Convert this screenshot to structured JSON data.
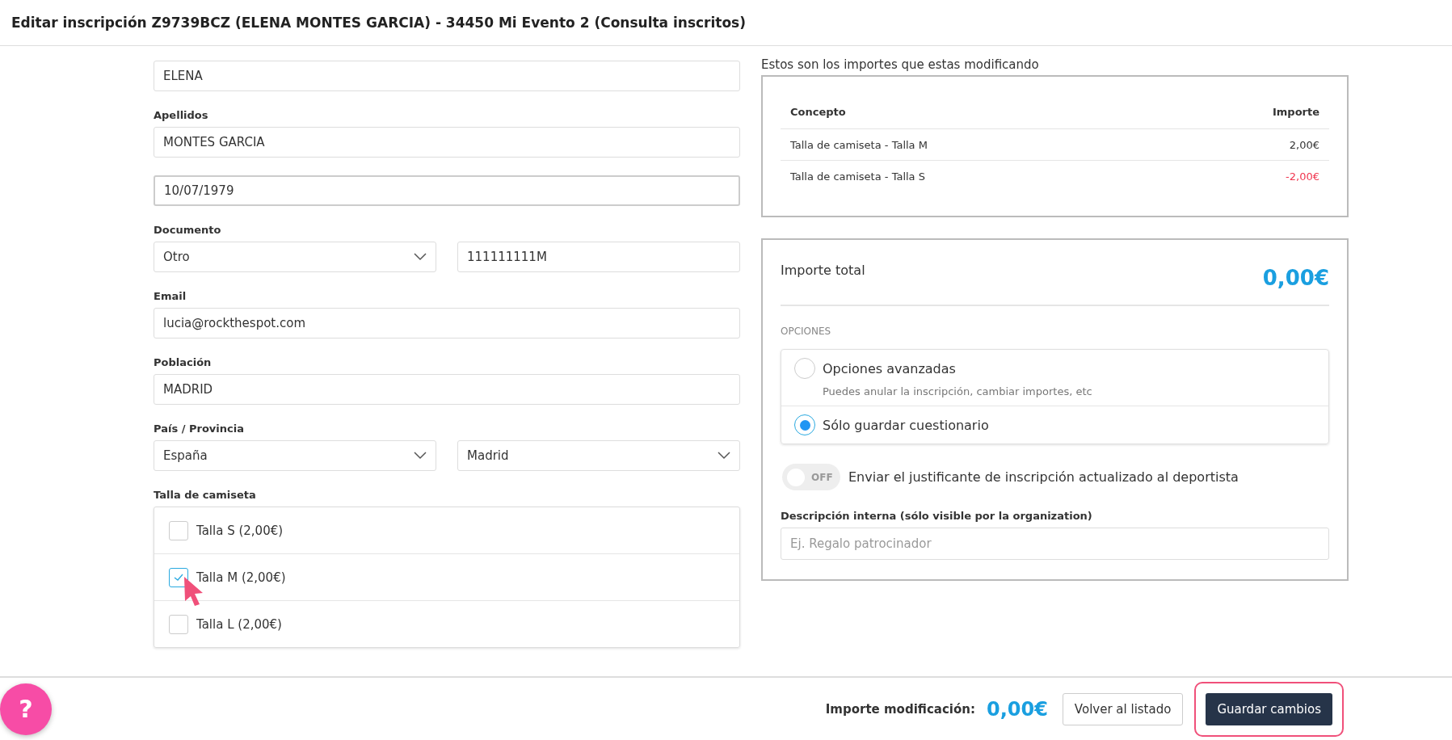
{
  "title": "Editar inscripción Z9739BCZ (ELENA MONTES GARCIA) - 34450 Mi Evento 2 (Consulta inscritos)",
  "form": {
    "rows": [
      {
        "controls": [
          {
            "kind": "input",
            "value": "ELENA"
          }
        ]
      },
      {
        "label": "Apellidos",
        "controls": [
          {
            "kind": "input",
            "value": "MONTES GARCIA"
          }
        ]
      },
      {
        "controls": [
          {
            "kind": "date",
            "value": "10/07/1979"
          }
        ]
      },
      {
        "label": "Documento",
        "controls": [
          {
            "kind": "select",
            "value": "Otro"
          },
          {
            "kind": "input",
            "value": "111111111M"
          }
        ]
      },
      {
        "label": "Email",
        "controls": [
          {
            "kind": "input",
            "value": "lucia@rockthespot.com"
          }
        ]
      },
      {
        "label": "Población",
        "controls": [
          {
            "kind": "input",
            "value": "MADRID"
          }
        ]
      },
      {
        "label": "País / Provincia",
        "controls": [
          {
            "kind": "select",
            "value": "España"
          },
          {
            "kind": "select",
            "value": "Madrid"
          }
        ]
      }
    ],
    "shirt": {
      "label": "Talla de camiseta",
      "options": [
        {
          "label": "Talla S (2,00€)",
          "checked": false
        },
        {
          "label": "Talla M (2,00€)",
          "checked": true
        },
        {
          "label": "Talla L (2,00€)",
          "checked": false
        }
      ]
    }
  },
  "summary": {
    "caption": "Estos son los importes que estas modificando",
    "columns": [
      "Concepto",
      "Importe"
    ],
    "rows": [
      {
        "concept": "Talla de camiseta - Talla M",
        "amount": "2,00€",
        "negative": false
      },
      {
        "concept": "Talla de camiseta - Talla S",
        "amount": "-2,00€",
        "negative": true
      }
    ]
  },
  "total": {
    "label": "Importe total",
    "value": "0,00€"
  },
  "options": {
    "heading": "OPCIONES",
    "choices": [
      {
        "label": "Opciones avanzadas",
        "hint": "Puedes anular la inscripción, cambiar importes, etc",
        "selected": false
      },
      {
        "label": "Sólo guardar cuestionario",
        "selected": true
      }
    ]
  },
  "toggle": {
    "on": false,
    "state_label": "OFF",
    "label": "Enviar el justificante de inscripción actualizado al deportista"
  },
  "description": {
    "label": "Descripción interna (sólo visible por la organization)",
    "placeholder": "Ej. Regalo patrocinador"
  },
  "footer": {
    "help": "?",
    "amount_label": "Importe modificación:",
    "amount": "0,00€",
    "buttons": [
      {
        "label": "Volver al listado",
        "kind": "secondary",
        "highlighted": false
      },
      {
        "label": "Guardar cambios",
        "kind": "primary",
        "highlighted": true
      }
    ]
  }
}
